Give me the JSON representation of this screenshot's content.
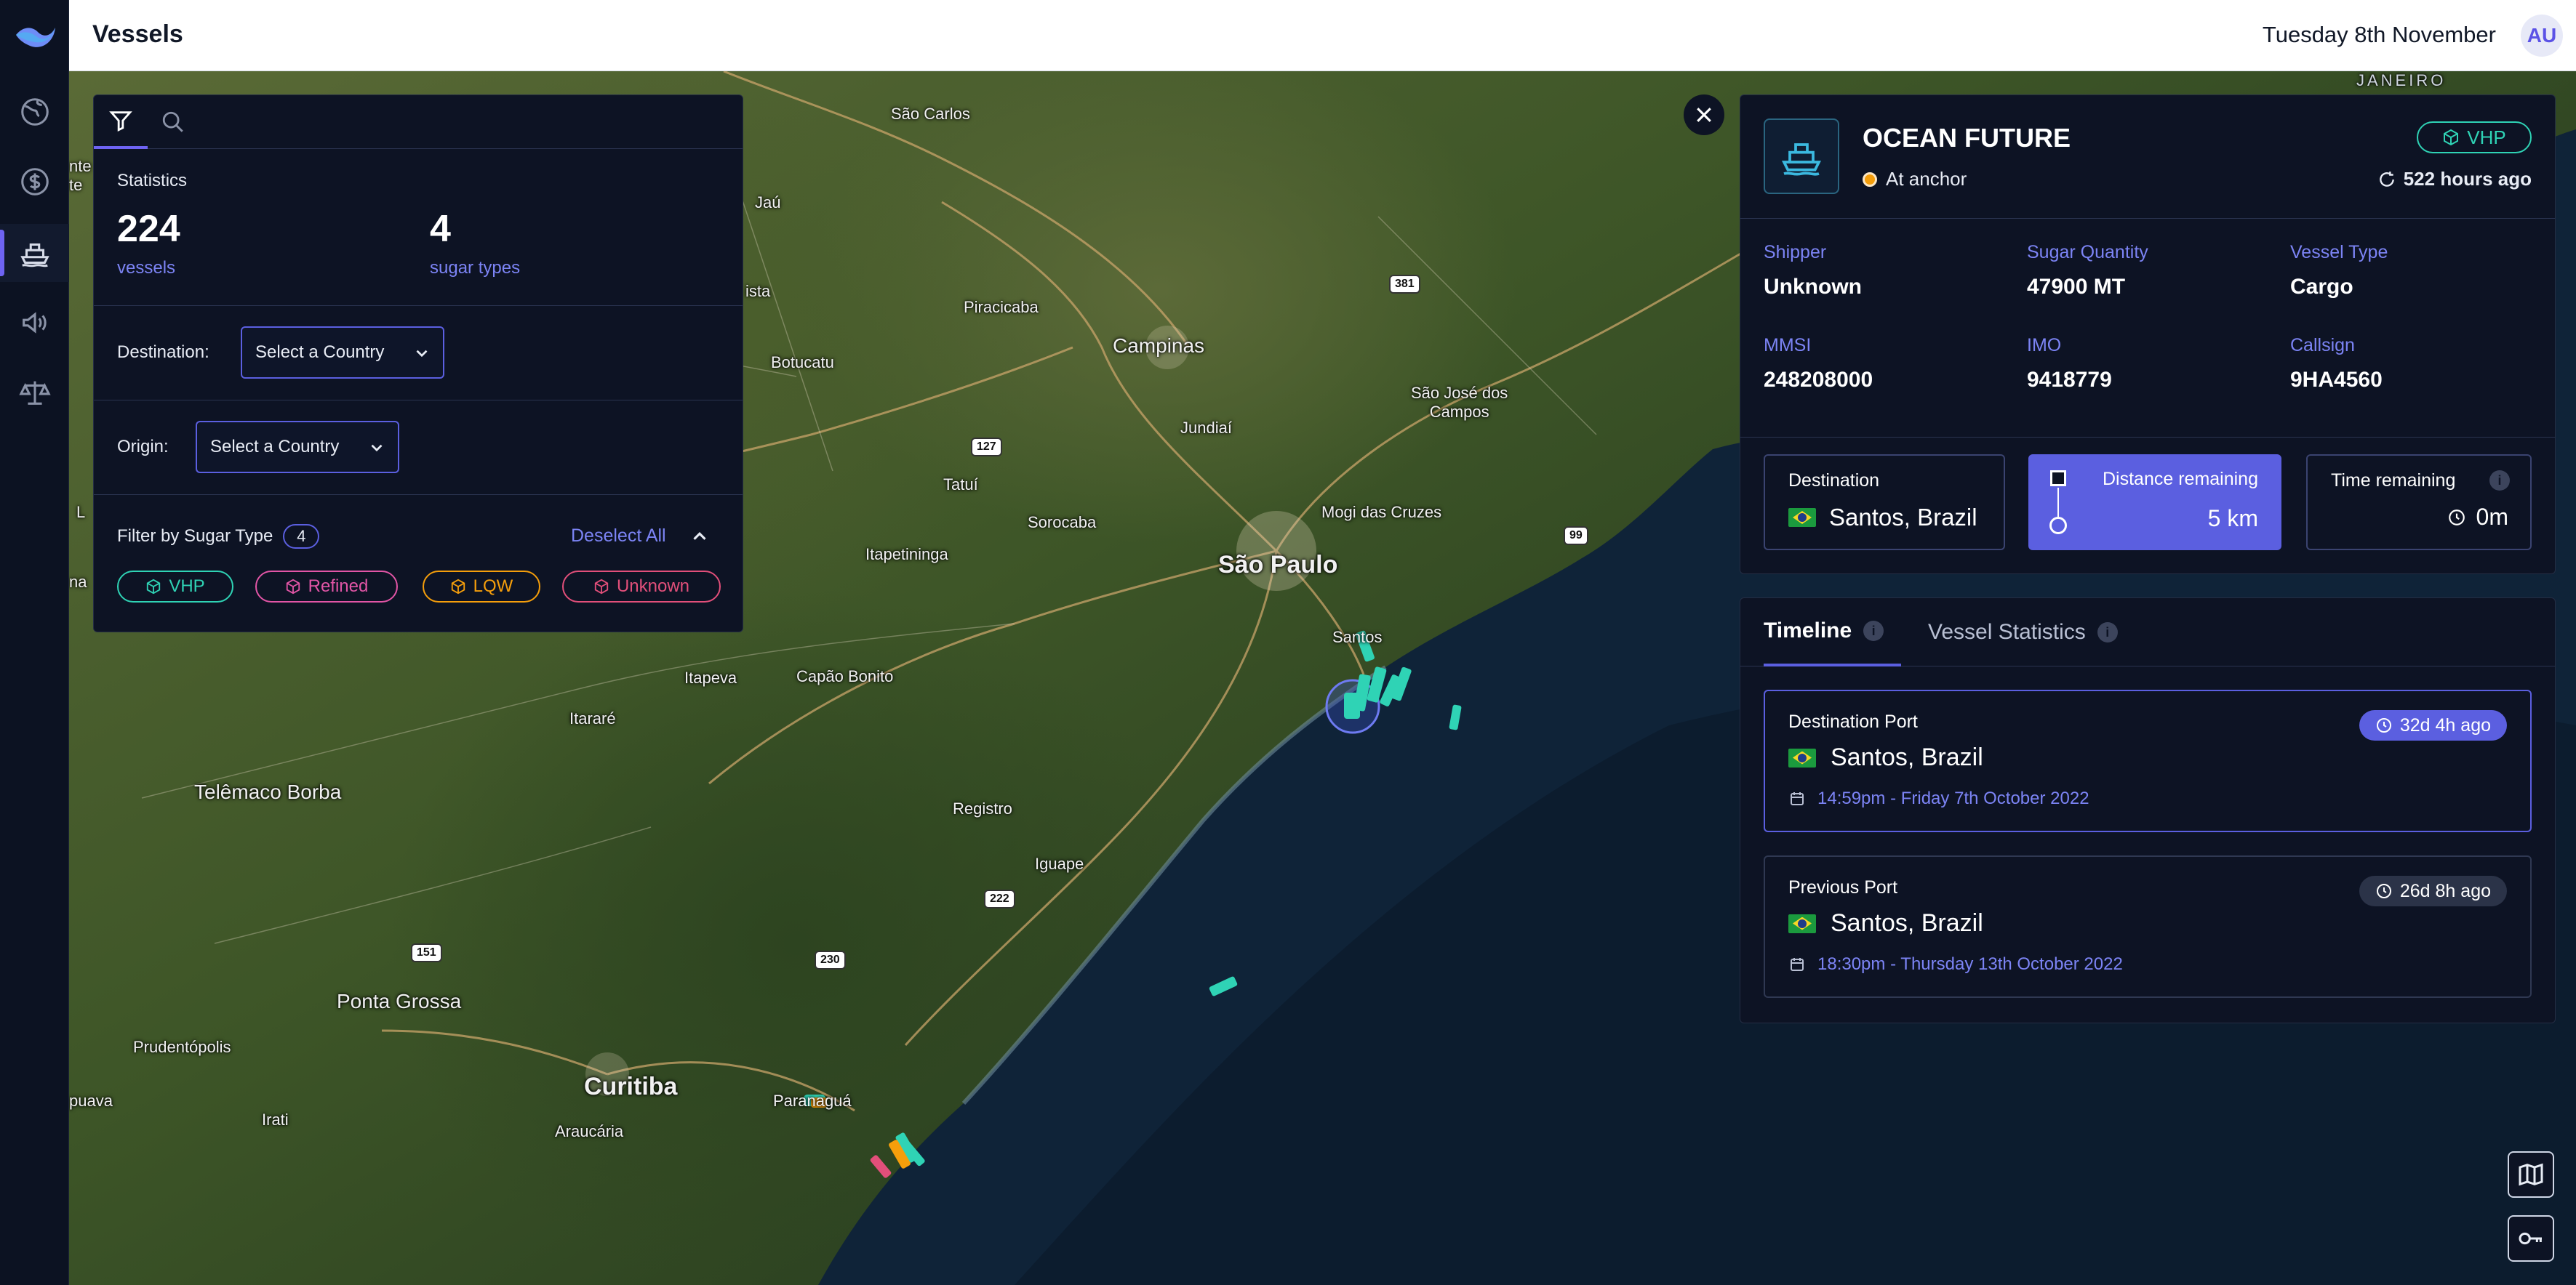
{
  "app": {
    "title": "Vessels",
    "date": "Tuesday 8th November",
    "user_initials": "AU"
  },
  "nav": {
    "items": [
      {
        "name": "globe-icon",
        "active": false
      },
      {
        "name": "dollar-icon",
        "active": false
      },
      {
        "name": "ship-icon",
        "active": true
      },
      {
        "name": "megaphone-icon",
        "active": false
      },
      {
        "name": "scales-icon",
        "active": false
      }
    ]
  },
  "filter_panel": {
    "statistics_title": "Statistics",
    "vessel_count": "224",
    "vessel_label": "vessels",
    "sugar_type_count": "4",
    "sugar_type_label": "sugar types",
    "destination_label": "Destination:",
    "destination_placeholder": "Select a Country",
    "origin_label": "Origin:",
    "origin_placeholder": "Select a Country",
    "sugar_filter_label": "Filter by Sugar Type",
    "sugar_filter_count": "4",
    "deselect_all": "Deselect All",
    "chips": [
      {
        "label": "VHP",
        "color": "#2fd3b5"
      },
      {
        "label": "Refined",
        "color": "#e255a6"
      },
      {
        "label": "LQW",
        "color": "#f59e0b"
      },
      {
        "label": "Unknown",
        "color": "#e24f7a"
      }
    ]
  },
  "vessel": {
    "name": "OCEAN FUTURE",
    "status": "At anchor",
    "sugar_badge": "VHP",
    "updated": "522 hours ago",
    "shipper_label": "Shipper",
    "shipper": "Unknown",
    "quantity_label": "Sugar Quantity",
    "quantity": "47900 MT",
    "type_label": "Vessel Type",
    "type": "Cargo",
    "mmsi_label": "MMSI",
    "mmsi": "248208000",
    "imo_label": "IMO",
    "imo": "9418779",
    "callsign_label": "Callsign",
    "callsign": "9HA4560",
    "destination_label": "Destination",
    "destination": "Santos, Brazil",
    "distance_label": "Distance remaining",
    "distance": "5 km",
    "time_label": "Time remaining",
    "time": "0m"
  },
  "timeline": {
    "tab_timeline": "Timeline",
    "tab_stats": "Vessel Statistics",
    "ports": [
      {
        "type": "Destination Port",
        "name": "Santos, Brazil",
        "time": "14:59pm - Friday 7th October 2022",
        "ago": "32d 4h ago"
      },
      {
        "type": "Previous Port",
        "name": "Santos, Brazil",
        "time": "18:30pm - Thursday 13th October 2022",
        "ago": "26d 8h ago"
      }
    ]
  },
  "map": {
    "places": {
      "sao_paulo": "São Paulo",
      "campinas": "Campinas",
      "curitiba": "Curitiba",
      "santos": "Santos",
      "sao_carlos": "São Carlos",
      "piracicaba": "Piracicaba",
      "jundiai": "Jundiaí",
      "sao_jose": "São José dos\nCampos",
      "mogi": "Mogi das Cruzes",
      "sorocaba": "Sorocaba",
      "itapetininga": "Itapetininga",
      "tatui": "Tatuí",
      "botucatu": "Botucatu",
      "jau": "Jaú",
      "itapeva": "Itapeva",
      "capao_bonito": "Capão Bonito",
      "itarare": "Itararé",
      "telemaco": "Telêmaco Borba",
      "registro": "Registro",
      "iguape": "Iguape",
      "ponta_grossa": "Ponta Grossa",
      "prudentopolis": "Prudentópolis",
      "irati": "Irati",
      "araucaria": "Araucária",
      "paranagua": "Paranaguá",
      "puava": "puava",
      "janeiro": "JANEIRO",
      "rodovia_381": "381",
      "rodovia_127": "127",
      "rodovia_99": "99",
      "rodovia_222": "222",
      "rodovia_230": "230",
      "rodovia_151": "151",
      "ista": "ista",
      "na": "na",
      "l": "L",
      "nte": "nte\nte"
    }
  }
}
